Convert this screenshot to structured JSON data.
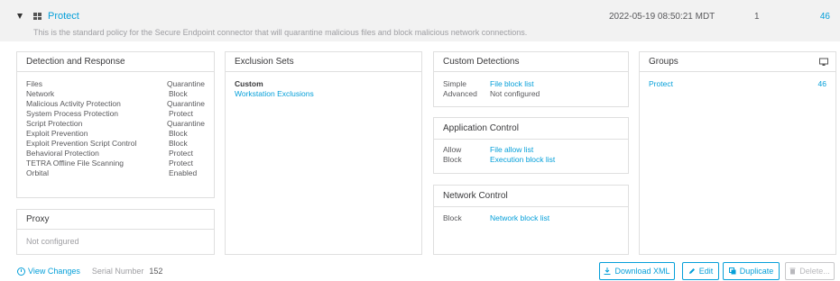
{
  "policy": {
    "name": "Protect",
    "description": "This is the standard policy for the Secure Endpoint connector that will quarantine malicious files and block malicious network connections.",
    "date": "2022-05-19 08:50:21 MDT",
    "number": "1",
    "count": "46"
  },
  "detection": {
    "title": "Detection and Response",
    "rows": [
      {
        "k": "Files",
        "v": "Quarantine"
      },
      {
        "k": "Network",
        "v": "Block"
      },
      {
        "k": "Malicious Activity Protection",
        "v": "Quarantine"
      },
      {
        "k": "System Process Protection",
        "v": "Protect"
      },
      {
        "k": "Script Protection",
        "v": "Quarantine"
      },
      {
        "k": "Exploit Prevention",
        "v": "Block"
      },
      {
        "k": "Exploit Prevention Script Control",
        "v": "Block"
      },
      {
        "k": "Behavioral Protection",
        "v": "Protect"
      },
      {
        "k": "TETRA Offline File Scanning",
        "v": "Protect"
      },
      {
        "k": "Orbital",
        "v": "Enabled"
      }
    ]
  },
  "proxy": {
    "title": "Proxy",
    "value": "Not configured"
  },
  "exclusions": {
    "title": "Exclusion Sets",
    "heading": "Custom",
    "item": "Workstation Exclusions"
  },
  "custom_detections": {
    "title": "Custom Detections",
    "rows": [
      {
        "k": "Simple",
        "v": "File block list"
      },
      {
        "k": "Advanced",
        "v": "Not configured"
      }
    ]
  },
  "app_control": {
    "title": "Application Control",
    "rows": [
      {
        "k": "Allow",
        "v": "File allow list"
      },
      {
        "k": "Block",
        "v": "Execution block list"
      }
    ]
  },
  "network_control": {
    "title": "Network Control",
    "rows": [
      {
        "k": "Block",
        "v": "Network block list"
      }
    ]
  },
  "groups": {
    "title": "Groups",
    "name": "Protect",
    "count": "46"
  },
  "footer": {
    "view_changes": "View Changes",
    "serial_label": "Serial Number",
    "serial_value": "152",
    "buttons": {
      "download": "Download XML",
      "edit": "Edit",
      "duplicate": "Duplicate",
      "delete": "Delete..."
    }
  },
  "icons": {
    "expand": "caret-down-icon",
    "os": "windows-icon",
    "groups": "monitor-icon",
    "view_changes": "clock-icon",
    "download": "download-icon",
    "edit": "pencil-icon",
    "duplicate": "duplicate-icon",
    "delete": "trash-icon"
  },
  "colors": {
    "accent": "#049fd9",
    "header_bg": "#f2f2f2",
    "border": "#dfdfdf"
  }
}
